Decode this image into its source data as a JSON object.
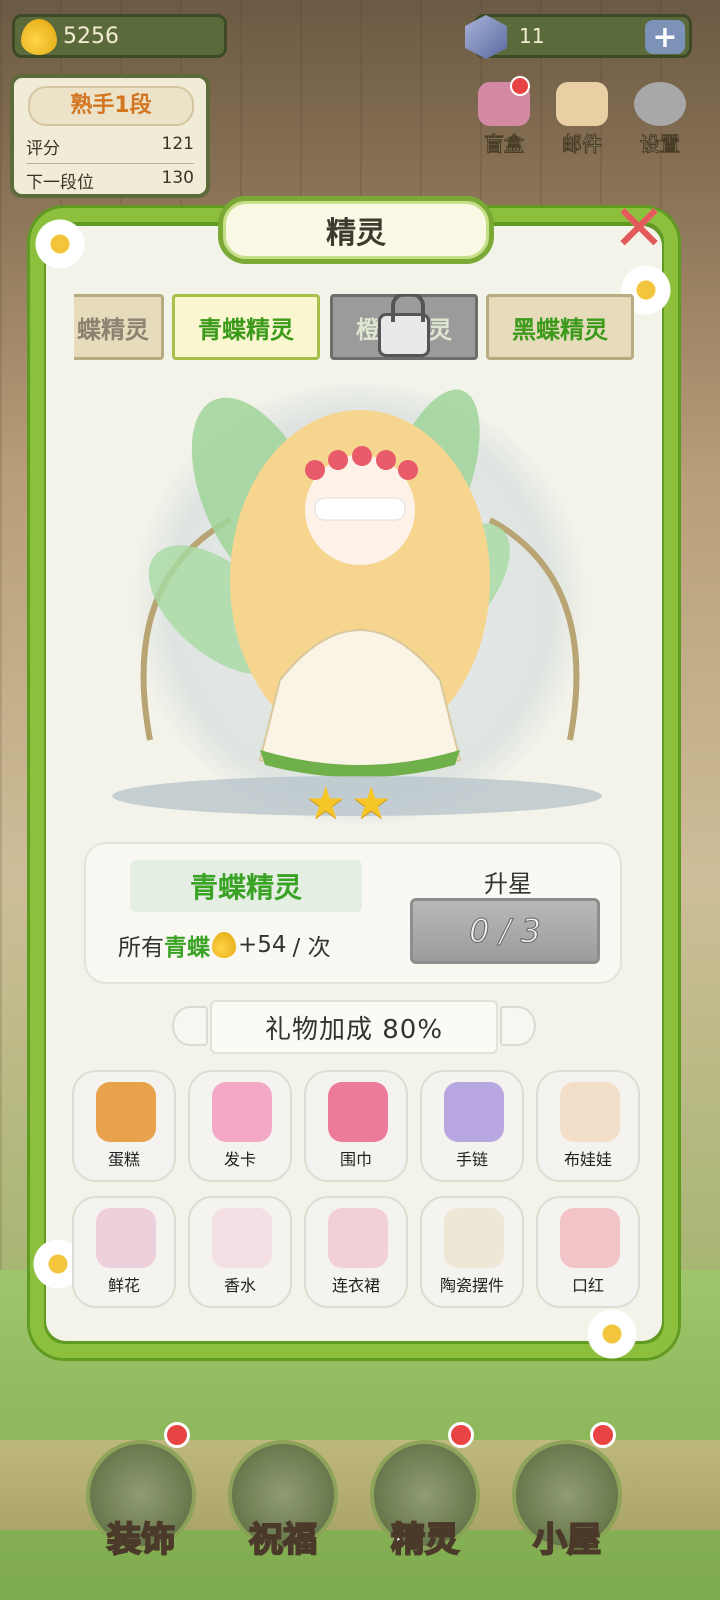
{
  "top": {
    "coins": "5256",
    "gems": "11",
    "plus": "+"
  },
  "rank": {
    "title": "熟手1段",
    "score_label": "评分",
    "score_value": "121",
    "next_label": "下一段位",
    "next_value": "130"
  },
  "top_icons": [
    {
      "label": "盲盒",
      "color": "#d48aa4",
      "badge": true
    },
    {
      "label": "邮件",
      "color": "#e8cfa4",
      "badge": false
    },
    {
      "label": "设置",
      "color": "#a8a8a8",
      "badge": false
    }
  ],
  "panel": {
    "title": "精灵",
    "close": "✕"
  },
  "tabs": [
    {
      "label": "蝶精灵",
      "state": "partial"
    },
    {
      "label": "青蝶精灵",
      "state": "active"
    },
    {
      "label": "橙蝶精灵",
      "state": "locked"
    },
    {
      "label": "黑蝶精灵",
      "state": "normal"
    }
  ],
  "fairy": {
    "stars": 2,
    "name": "青蝶精灵",
    "bonus_prefix": "所有",
    "bonus_target": "青蝶",
    "bonus_value": "+54",
    "bonus_suffix": "/ 次",
    "upstar_label": "升星",
    "upstar_progress": "0 / 3"
  },
  "gift_bonus": "礼物加成 80%",
  "gifts": [
    {
      "name": "蛋糕",
      "color": "#e8a24b",
      "owned": true
    },
    {
      "name": "发卡",
      "color": "#f3a9c6",
      "owned": true
    },
    {
      "name": "围巾",
      "color": "#ee7a9a",
      "owned": true
    },
    {
      "name": "手链",
      "color": "#b7a6e0",
      "owned": true
    },
    {
      "name": "布娃娃",
      "color": "#f1c69b",
      "owned": false
    },
    {
      "name": "鲜花",
      "color": "#e7a7c6",
      "owned": false
    },
    {
      "name": "香水",
      "color": "#f2c7d7",
      "owned": false
    },
    {
      "name": "连衣裙",
      "color": "#f0a9b9",
      "owned": false
    },
    {
      "name": "陶瓷摆件",
      "color": "#e9d9b8",
      "owned": false
    },
    {
      "name": "口红",
      "color": "#ef8c9a",
      "owned": false
    }
  ],
  "nav": [
    {
      "label": "装饰",
      "badge": true
    },
    {
      "label": "祝福",
      "badge": false
    },
    {
      "label": "精灵",
      "badge": true
    },
    {
      "label": "小屋",
      "badge": true
    }
  ]
}
